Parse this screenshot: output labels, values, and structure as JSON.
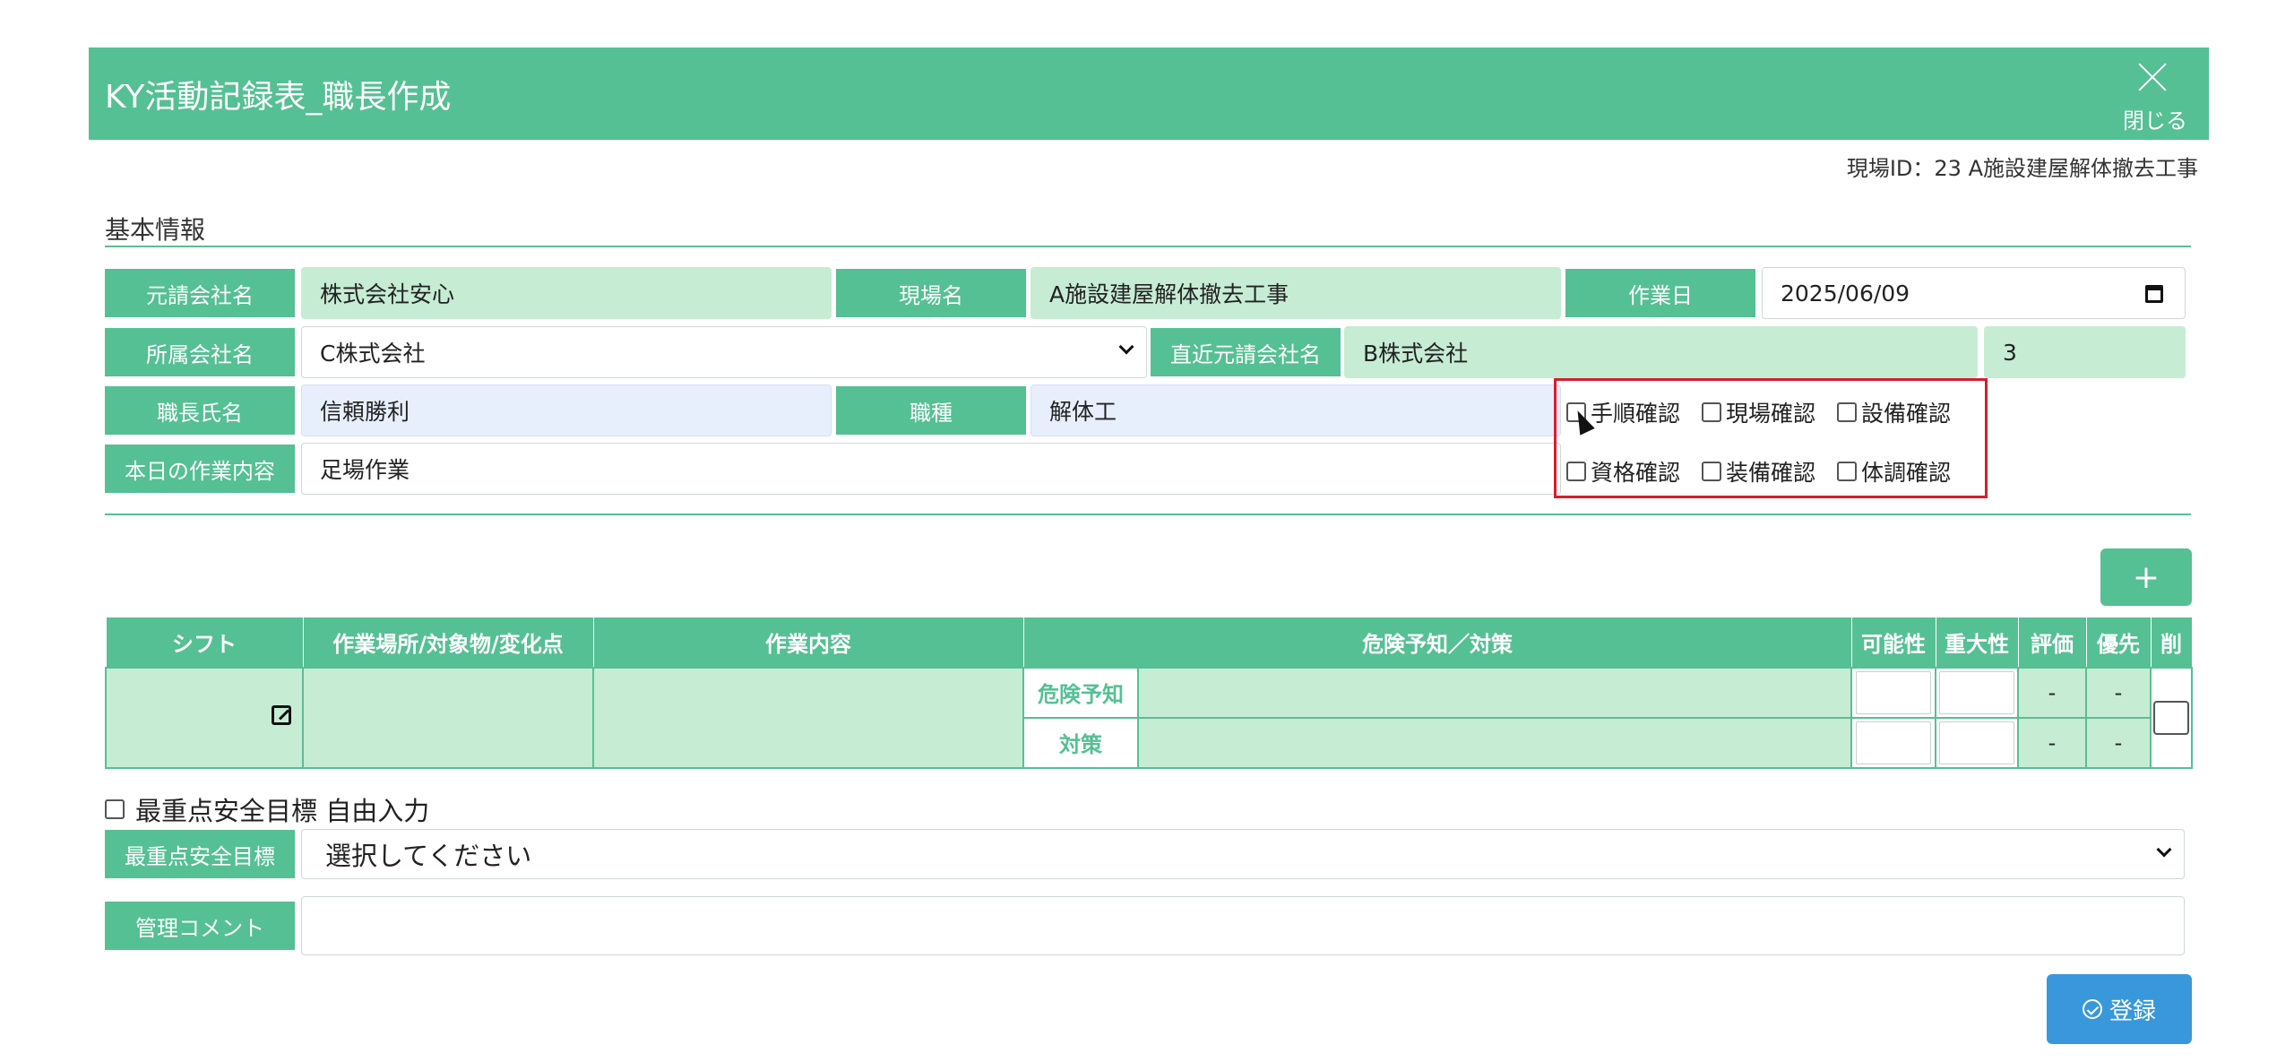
{
  "header": {
    "title": "KY活動記録表_職長作成",
    "close_label": "閉じる"
  },
  "site_id": "現場ID：23 A施設建屋解体撤去工事",
  "section": {
    "title": "基本情報"
  },
  "form": {
    "prime_contractor_label": "元請会社名",
    "prime_contractor_value": "株式会社安心",
    "site_name_label": "現場名",
    "site_name_value": "A施設建屋解体撤去工事",
    "work_date_label": "作業日",
    "work_date_value": "2025/06/09",
    "affiliated_company_label": "所属会社名",
    "affiliated_company_value": "C株式会社",
    "direct_prime_label": "直近元請会社名",
    "direct_prime_value": "B株式会社",
    "direct_prime_number": "3",
    "foreman_label": "職長氏名",
    "foreman_value": "信頼勝利",
    "trade_label": "職種",
    "trade_value": "解体工",
    "today_work_label": "本日の作業内容",
    "today_work_value": "足場作業"
  },
  "checks": [
    "手順確認",
    "現場確認",
    "設備確認",
    "資格確認",
    "装備確認",
    "体調確認"
  ],
  "table": {
    "headers": [
      "シフト",
      "作業場所/対象物/変化点",
      "作業内容",
      "危険予知／対策",
      "可能性",
      "重大性",
      "評価",
      "優先",
      "削"
    ],
    "row_labels": [
      "危険予知",
      "対策"
    ],
    "dash": "-"
  },
  "add_button": "+",
  "free_input_label": "最重点安全目標 自由入力",
  "safety_goal_label": "最重点安全目標",
  "safety_goal_select": "選択してください",
  "comment_label": "管理コメント",
  "register_button": "登録"
}
